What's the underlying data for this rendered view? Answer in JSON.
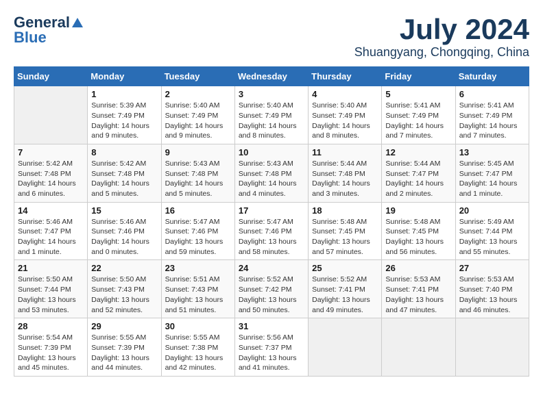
{
  "header": {
    "logo_general": "General",
    "logo_blue": "Blue",
    "month": "July 2024",
    "location": "Shuangyang, Chongqing, China"
  },
  "days_of_week": [
    "Sunday",
    "Monday",
    "Tuesday",
    "Wednesday",
    "Thursday",
    "Friday",
    "Saturday"
  ],
  "weeks": [
    [
      {
        "day": "",
        "empty": true
      },
      {
        "day": "1",
        "sunrise": "5:39 AM",
        "sunset": "7:49 PM",
        "daylight": "14 hours and 9 minutes."
      },
      {
        "day": "2",
        "sunrise": "5:40 AM",
        "sunset": "7:49 PM",
        "daylight": "14 hours and 9 minutes."
      },
      {
        "day": "3",
        "sunrise": "5:40 AM",
        "sunset": "7:49 PM",
        "daylight": "14 hours and 8 minutes."
      },
      {
        "day": "4",
        "sunrise": "5:40 AM",
        "sunset": "7:49 PM",
        "daylight": "14 hours and 8 minutes."
      },
      {
        "day": "5",
        "sunrise": "5:41 AM",
        "sunset": "7:49 PM",
        "daylight": "14 hours and 7 minutes."
      },
      {
        "day": "6",
        "sunrise": "5:41 AM",
        "sunset": "7:49 PM",
        "daylight": "14 hours and 7 minutes."
      }
    ],
    [
      {
        "day": "7",
        "sunrise": "5:42 AM",
        "sunset": "7:48 PM",
        "daylight": "14 hours and 6 minutes."
      },
      {
        "day": "8",
        "sunrise": "5:42 AM",
        "sunset": "7:48 PM",
        "daylight": "14 hours and 5 minutes."
      },
      {
        "day": "9",
        "sunrise": "5:43 AM",
        "sunset": "7:48 PM",
        "daylight": "14 hours and 5 minutes."
      },
      {
        "day": "10",
        "sunrise": "5:43 AM",
        "sunset": "7:48 PM",
        "daylight": "14 hours and 4 minutes."
      },
      {
        "day": "11",
        "sunrise": "5:44 AM",
        "sunset": "7:48 PM",
        "daylight": "14 hours and 3 minutes."
      },
      {
        "day": "12",
        "sunrise": "5:44 AM",
        "sunset": "7:47 PM",
        "daylight": "14 hours and 2 minutes."
      },
      {
        "day": "13",
        "sunrise": "5:45 AM",
        "sunset": "7:47 PM",
        "daylight": "14 hours and 1 minute."
      }
    ],
    [
      {
        "day": "14",
        "sunrise": "5:46 AM",
        "sunset": "7:47 PM",
        "daylight": "14 hours and 1 minute."
      },
      {
        "day": "15",
        "sunrise": "5:46 AM",
        "sunset": "7:46 PM",
        "daylight": "14 hours and 0 minutes."
      },
      {
        "day": "16",
        "sunrise": "5:47 AM",
        "sunset": "7:46 PM",
        "daylight": "13 hours and 59 minutes."
      },
      {
        "day": "17",
        "sunrise": "5:47 AM",
        "sunset": "7:46 PM",
        "daylight": "13 hours and 58 minutes."
      },
      {
        "day": "18",
        "sunrise": "5:48 AM",
        "sunset": "7:45 PM",
        "daylight": "13 hours and 57 minutes."
      },
      {
        "day": "19",
        "sunrise": "5:48 AM",
        "sunset": "7:45 PM",
        "daylight": "13 hours and 56 minutes."
      },
      {
        "day": "20",
        "sunrise": "5:49 AM",
        "sunset": "7:44 PM",
        "daylight": "13 hours and 55 minutes."
      }
    ],
    [
      {
        "day": "21",
        "sunrise": "5:50 AM",
        "sunset": "7:44 PM",
        "daylight": "13 hours and 53 minutes."
      },
      {
        "day": "22",
        "sunrise": "5:50 AM",
        "sunset": "7:43 PM",
        "daylight": "13 hours and 52 minutes."
      },
      {
        "day": "23",
        "sunrise": "5:51 AM",
        "sunset": "7:43 PM",
        "daylight": "13 hours and 51 minutes."
      },
      {
        "day": "24",
        "sunrise": "5:52 AM",
        "sunset": "7:42 PM",
        "daylight": "13 hours and 50 minutes."
      },
      {
        "day": "25",
        "sunrise": "5:52 AM",
        "sunset": "7:41 PM",
        "daylight": "13 hours and 49 minutes."
      },
      {
        "day": "26",
        "sunrise": "5:53 AM",
        "sunset": "7:41 PM",
        "daylight": "13 hours and 47 minutes."
      },
      {
        "day": "27",
        "sunrise": "5:53 AM",
        "sunset": "7:40 PM",
        "daylight": "13 hours and 46 minutes."
      }
    ],
    [
      {
        "day": "28",
        "sunrise": "5:54 AM",
        "sunset": "7:39 PM",
        "daylight": "13 hours and 45 minutes."
      },
      {
        "day": "29",
        "sunrise": "5:55 AM",
        "sunset": "7:39 PM",
        "daylight": "13 hours and 44 minutes."
      },
      {
        "day": "30",
        "sunrise": "5:55 AM",
        "sunset": "7:38 PM",
        "daylight": "13 hours and 42 minutes."
      },
      {
        "day": "31",
        "sunrise": "5:56 AM",
        "sunset": "7:37 PM",
        "daylight": "13 hours and 41 minutes."
      },
      {
        "day": "",
        "empty": true
      },
      {
        "day": "",
        "empty": true
      },
      {
        "day": "",
        "empty": true
      }
    ]
  ]
}
